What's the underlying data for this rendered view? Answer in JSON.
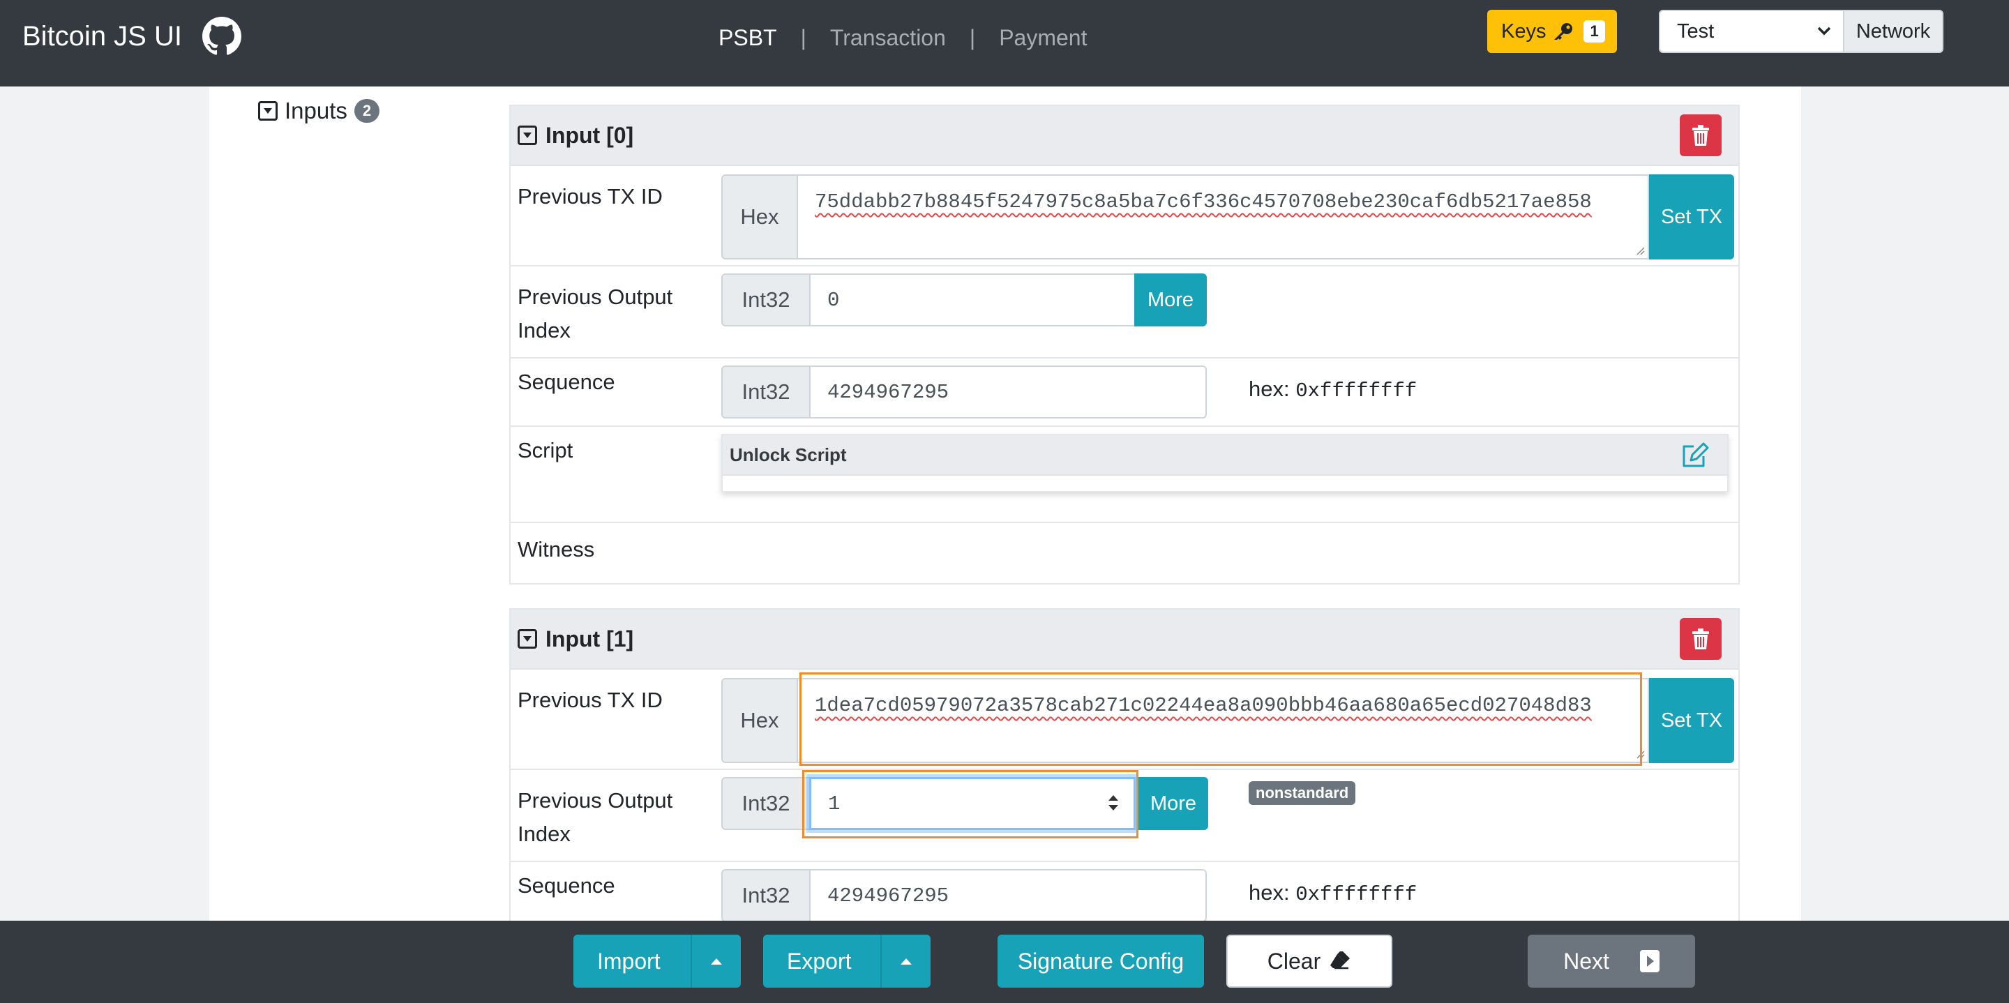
{
  "navbar": {
    "brand": "Bitcoin JS UI",
    "links": [
      "PSBT",
      "Transaction",
      "Payment"
    ],
    "separator": "|",
    "keys_label": "Keys",
    "keys_count": "1",
    "network_selected": "Test",
    "network_label": "Network"
  },
  "inputs_section": {
    "title": "Inputs",
    "count": "2"
  },
  "inputs": [
    {
      "title": "Input [0]",
      "prev_txid_label": "Previous TX ID",
      "prev_txid_addon": "Hex",
      "prev_txid_value": "75ddabb27b8845f5247975c8a5ba7c6f336c4570708ebe230caf6db5217ae858",
      "set_tx_label": "Set TX",
      "prev_output_label": "Previous Output Index",
      "prev_output_addon": "Int32",
      "prev_output_value": "0",
      "more_label": "More",
      "sequence_label": "Sequence",
      "sequence_addon": "Int32",
      "sequence_value": "4294967295",
      "hex_prefix": "hex:",
      "hex_value": "0xffffffff",
      "script_label": "Script",
      "unlock_script_title": "Unlock Script",
      "witness_label": "Witness"
    },
    {
      "title": "Input [1]",
      "prev_txid_label": "Previous TX ID",
      "prev_txid_addon": "Hex",
      "prev_txid_value": "1dea7cd05979072a3578cab271c02244ea8a090bbb46aa680a65ecd027048d83",
      "set_tx_label": "Set TX",
      "prev_output_label": "Previous Output Index",
      "prev_output_addon": "Int32",
      "prev_output_value": "1",
      "more_label": "More",
      "badge": "nonstandard",
      "sequence_label": "Sequence",
      "sequence_addon": "Int32",
      "sequence_value": "4294967295",
      "hex_prefix": "hex:",
      "hex_value": "0xffffffff"
    }
  ],
  "bottombar": {
    "import_label": "Import",
    "export_label": "Export",
    "signature_config_label": "Signature Config",
    "clear_label": "Clear",
    "next_label": "Next"
  },
  "colors": {
    "navbar_bg": "#343a40",
    "teal": "#17a2b8",
    "danger": "#dc3545",
    "warning": "#ffc107",
    "focus_outline": "#f28c28"
  }
}
